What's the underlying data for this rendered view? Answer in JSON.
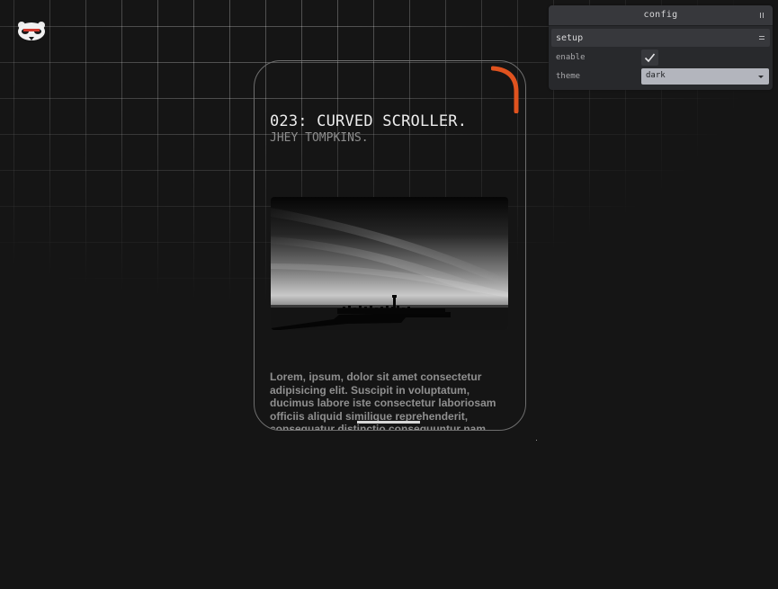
{
  "colors": {
    "background": "#151515",
    "accent": "#e0531f",
    "grid": "#ffffff",
    "card_border": "#6e6e6e",
    "panel": "#28292c"
  },
  "logo": {
    "icon": "panda-icon"
  },
  "card": {
    "title": "023: CURVED SCROLLER.",
    "author": "JHEY TOMPKINS.",
    "image": {
      "icon": "pier-sunset-photo"
    },
    "body": "Lorem, ipsum, dolor sit amet consectetur adipisicing elit. Suscipit in voluptatum, ducimus labore iste consectetur laboriosam officiis aliquid similique reprehenderit, consequatur distinctio consequuntur nam magnam blanditiis"
  },
  "config": {
    "title": "config",
    "pause_icon": "pause-icon",
    "section": {
      "title": "setup",
      "handle_icon": "drag-handle-icon"
    },
    "enable": {
      "label": "enable",
      "checked": true
    },
    "theme": {
      "label": "theme",
      "value": "dark"
    }
  }
}
